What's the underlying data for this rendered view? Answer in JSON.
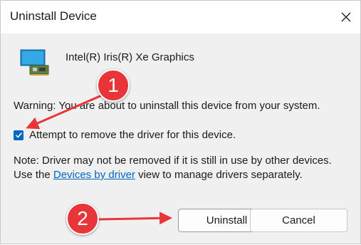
{
  "window": {
    "title": "Uninstall Device"
  },
  "device": {
    "name": "Intel(R) Iris(R) Xe Graphics",
    "icon": "display-adapter-icon"
  },
  "warning": "Warning: You are about to uninstall this device from your system.",
  "option": {
    "label": "Attempt to remove the driver for this device.",
    "checked": true
  },
  "note": {
    "before": "Note: Driver may not be removed if it is still in use by other devices. Use the ",
    "link": "Devices by driver",
    "after": " view to manage drivers separately."
  },
  "buttons": {
    "uninstall": "Uninstall",
    "cancel": "Cancel"
  },
  "annotations": {
    "badge1": "1",
    "badge2": "2"
  },
  "colors": {
    "accent": "#0067c0",
    "annotation": "#e8353a"
  }
}
